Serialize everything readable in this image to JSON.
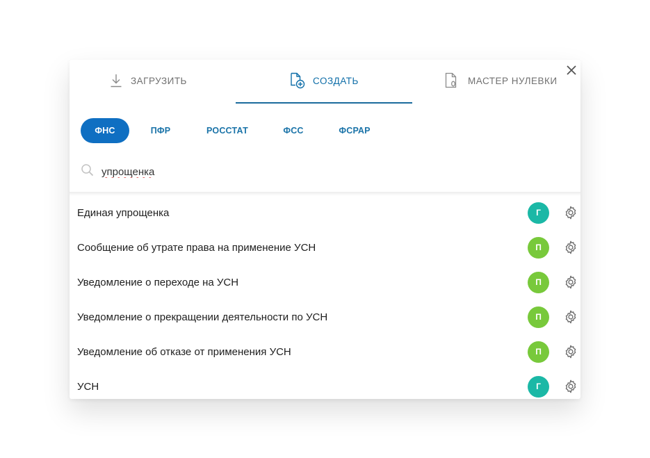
{
  "tabs": [
    {
      "label": "ЗАГРУЗИТЬ",
      "icon": "download-icon",
      "active": false
    },
    {
      "label": "СОЗДАТЬ",
      "icon": "create-document-icon",
      "active": true
    },
    {
      "label": "МАСТЕР НУЛЕВКИ",
      "icon": "zero-report-icon",
      "active": false
    }
  ],
  "chips": [
    {
      "label": "ФНС",
      "active": true
    },
    {
      "label": "ПФР",
      "active": false
    },
    {
      "label": "РОССТАТ",
      "active": false
    },
    {
      "label": "ФСС",
      "active": false
    },
    {
      "label": "ФСРАР",
      "active": false
    }
  ],
  "search": {
    "value": "упрощенка",
    "icon": "search-icon"
  },
  "results": [
    {
      "title": "Единая упрощенка",
      "badge": "Г",
      "badge_color": "#1bb8a6"
    },
    {
      "title": "Сообщение об утрате права на применение УСН",
      "badge": "П",
      "badge_color": "#78c93b"
    },
    {
      "title": "Уведомление о переходе на УСН",
      "badge": "П",
      "badge_color": "#78c93b"
    },
    {
      "title": "Уведомление о прекращении деятельности по УСН",
      "badge": "П",
      "badge_color": "#78c93b"
    },
    {
      "title": "Уведомление об отказе от применения УСН",
      "badge": "П",
      "badge_color": "#78c93b"
    },
    {
      "title": "УСН",
      "badge": "Г",
      "badge_color": "#1bb8a6"
    }
  ],
  "colors": {
    "accent": "#0f6fc2",
    "tab_active": "#0f6ea8",
    "tab_underline": "#1a6b9d"
  }
}
